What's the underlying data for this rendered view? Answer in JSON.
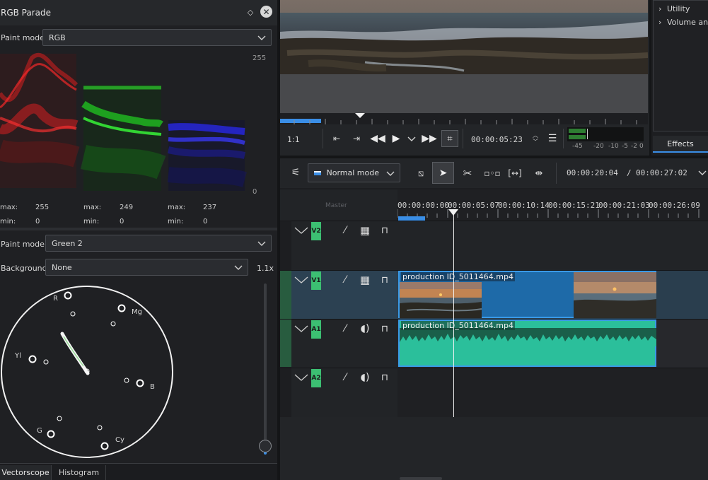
{
  "rgb_parade": {
    "title": "RGB Parade",
    "paint_mode_label": "Paint mode",
    "paint_mode_value": "RGB",
    "scale_max": "255",
    "scale_min": "0",
    "stats": [
      {
        "max_label": "max:",
        "max": "255",
        "min_label": "min:",
        "min": "0"
      },
      {
        "max_label": "max:",
        "max": "249",
        "min_label": "min:",
        "min": "0"
      },
      {
        "max_label": "max:",
        "max": "237",
        "min_label": "min:",
        "min": "0"
      }
    ]
  },
  "vectorscope": {
    "paint_mode_label": "Paint mode",
    "paint_mode_value": "Green 2",
    "background_label": "Background",
    "background_value": "None",
    "zoom": "1.1x",
    "targets": [
      "R",
      "Mg",
      "Yl",
      "B",
      "G",
      "Cy"
    ],
    "zoom_level": 0.1
  },
  "bottom_tabs": [
    "Vectorscope",
    "Histogram"
  ],
  "monitor": {
    "zoom": "1:1",
    "timecode": "00:00:05:23",
    "audio_scale": [
      "-45",
      "-20",
      "-10",
      "-5",
      "-2",
      "0"
    ]
  },
  "effects": {
    "items": [
      "Utility",
      "Volume and"
    ],
    "tab": "Effects"
  },
  "timeline": {
    "mode": "Normal mode",
    "position": "00:00:20:04",
    "separator": "/",
    "duration": "00:00:27:02",
    "header_master": "Master",
    "ruler": [
      "00:00:00:00",
      "00:00:05:07",
      "00:00:10:14",
      "00:00:15:21",
      "00:00:21:03",
      "00:00:26:09"
    ],
    "tracks": [
      "V2",
      "V1",
      "A1",
      "A2"
    ],
    "clip_video": "production ID_5011464.mp4",
    "clip_audio": "production ID_5011464.mp4"
  },
  "colors": {
    "accent_blue": "#3a8ee6",
    "track_green": "#3cbf72",
    "clip_blue": "#1e6aa8",
    "audio_teal": "#2bbf9b"
  }
}
